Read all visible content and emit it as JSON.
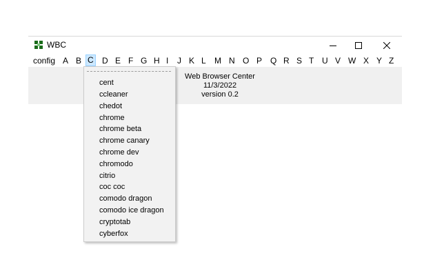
{
  "window": {
    "title": "WBC",
    "controls": [
      "minimize",
      "maximize",
      "close"
    ]
  },
  "menubar": {
    "config": "config",
    "letters": [
      "A",
      "B",
      "C",
      "D",
      "E",
      "F",
      "G",
      "H",
      "I",
      "J",
      "K",
      "L",
      "M",
      "N",
      "O",
      "P",
      "Q",
      "R",
      "S",
      "T",
      "U",
      "V",
      "W",
      "X",
      "Y",
      "Z"
    ],
    "active": "C"
  },
  "info": {
    "name": "Web Browser Center",
    "date": "11/3/2022",
    "version": "version 0.2"
  },
  "dropdown": {
    "items": [
      "cent",
      "ccleaner",
      "chedot",
      "chrome",
      "chrome beta",
      "chrome canary",
      "chrome dev",
      "chromodo",
      "citrio",
      "coc coc",
      "comodo dragon",
      "comodo ice dragon",
      "cryptotab",
      "cyberfox"
    ]
  },
  "icons": {
    "app": "app-icon",
    "minimize": "minimize-icon",
    "maximize": "maximize-icon",
    "close": "close-icon"
  },
  "colors": {
    "app_icon": "#1a6b1a",
    "menu_active_bg": "#cce8ff",
    "menu_active_border": "#99d1ff",
    "window_bg": "#f0f0f0"
  }
}
